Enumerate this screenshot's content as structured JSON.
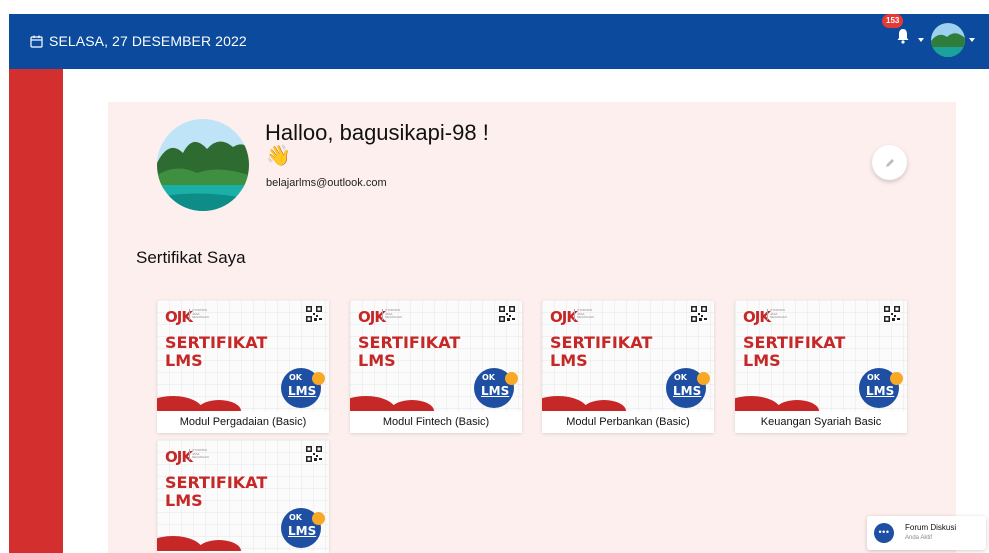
{
  "header": {
    "date": "SELASA, 27 DESEMBER 2022",
    "notification_count": "153",
    "colors": {
      "bar": "#0b4a9c",
      "badge": "#e53935"
    }
  },
  "profile": {
    "greeting": "Halloo, bagusikapi-98 !",
    "wave": "👋",
    "email": "belajarlms@outlook.com"
  },
  "certificates": {
    "section_title": "Sertifikat Saya",
    "card_brand": "OJK",
    "card_brand_sub": "OTORITAS JASA KEUANGAN",
    "card_title_line1": "SERTIFIKAT",
    "card_title_line2": "LMS",
    "lms_badge_top": "OK",
    "lms_badge": "LMS",
    "items": [
      {
        "caption": "Modul Pergadaian (Basic)"
      },
      {
        "caption": "Modul Fintech (Basic)"
      },
      {
        "caption": "Modul Perbankan (Basic)"
      },
      {
        "caption": "Keuangan Syariah Basic"
      },
      {
        "caption": ""
      }
    ]
  },
  "forum": {
    "title": "Forum Diskusi",
    "status": "Anda Aktif"
  },
  "colors": {
    "sidebar": "#d32f2f",
    "panel": "#fcefed",
    "accent_red": "#c62828",
    "lms_blue": "#1e4fa3"
  }
}
